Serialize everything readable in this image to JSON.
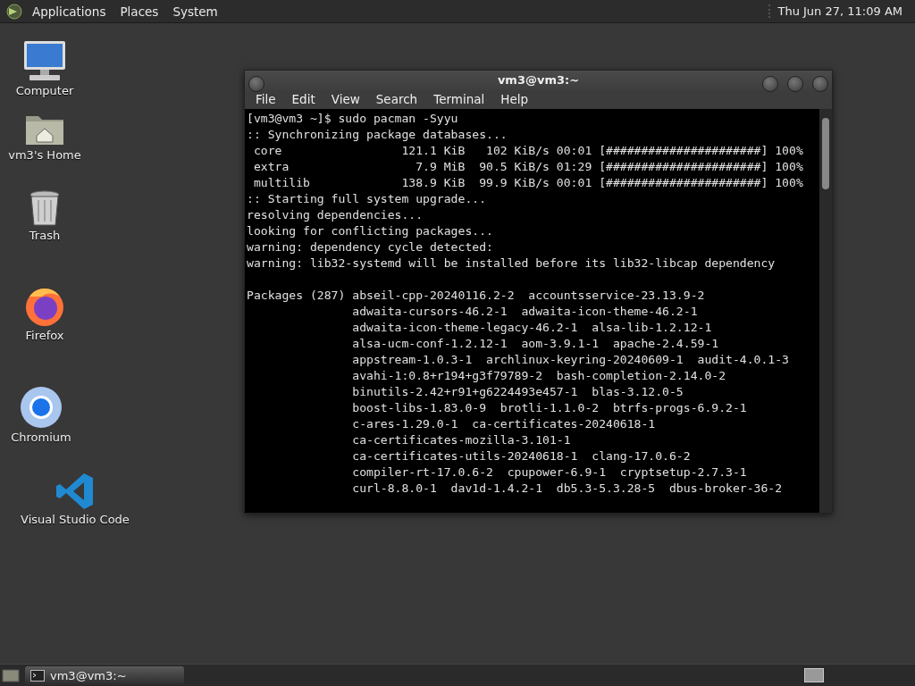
{
  "top_panel": {
    "menus": [
      "Applications",
      "Places",
      "System"
    ],
    "clock": "Thu Jun 27, 11:09 AM"
  },
  "desktop_icons": [
    {
      "label": "Computer",
      "kind": "computer"
    },
    {
      "label": "vm3's Home",
      "kind": "home"
    },
    {
      "label": "Trash",
      "kind": "trash"
    },
    {
      "label": "Firefox",
      "kind": "firefox"
    },
    {
      "label": "Chromium",
      "kind": "chromium"
    },
    {
      "label": "Visual Studio Code",
      "kind": "code"
    }
  ],
  "window": {
    "title": "vm3@vm3:~",
    "menu": [
      "File",
      "Edit",
      "View",
      "Search",
      "Terminal",
      "Help"
    ],
    "blocks": [
      [
        "[vm3@vm3 ~]$ sudo pacman -Syyu",
        ":: Synchronizing package databases...",
        " core                 121.1 KiB   102 KiB/s 00:01 [######################] 100%",
        " extra                  7.9 MiB  90.5 KiB/s 01:29 [######################] 100%",
        " multilib             138.9 KiB  99.9 KiB/s 00:01 [######################] 100%",
        ":: Starting full system upgrade...",
        "resolving dependencies...",
        "looking for conflicting packages...",
        "warning: dependency cycle detected:",
        "warning: lib32-systemd will be installed before its lib32-libcap dependency"
      ],
      [
        "Packages (287) abseil-cpp-20240116.2-2  accountsservice-23.13.9-2",
        "               adwaita-cursors-46.2-1  adwaita-icon-theme-46.2-1",
        "               adwaita-icon-theme-legacy-46.2-1  alsa-lib-1.2.12-1",
        "               alsa-ucm-conf-1.2.12-1  aom-3.9.1-1  apache-2.4.59-1",
        "               appstream-1.0.3-1  archlinux-keyring-20240609-1  audit-4.0.1-3",
        "               avahi-1:0.8+r194+g3f79789-2  bash-completion-2.14.0-2",
        "               binutils-2.42+r91+g6224493e457-1  blas-3.12.0-5",
        "               boost-libs-1.83.0-9  brotli-1.1.0-2  btrfs-progs-6.9.2-1",
        "               c-ares-1.29.0-1  ca-certificates-20240618-1",
        "               ca-certificates-mozilla-3.101-1",
        "               ca-certificates-utils-20240618-1  clang-17.0.6-2",
        "               compiler-rt-17.0.6-2  cpupower-6.9-1  cryptsetup-2.7.3-1",
        "               curl-8.8.0-1  dav1d-1.4.2-1  db5.3-5.3.28-5  dbus-broker-36-2"
      ]
    ]
  },
  "taskbar": {
    "tasks": [
      "vm3@vm3:~"
    ]
  }
}
